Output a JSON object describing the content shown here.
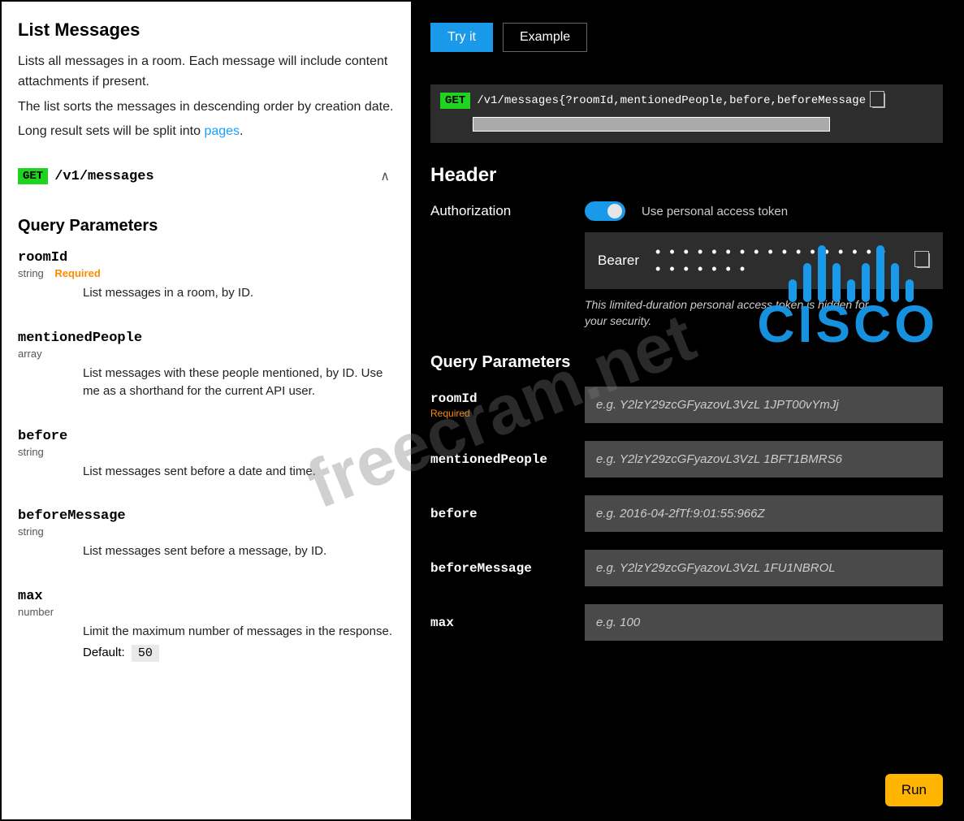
{
  "left": {
    "title": "List Messages",
    "desc1": "Lists all messages in a room. Each message will include content attachments if present.",
    "desc2": "The list sorts the messages in descending order by creation date.",
    "desc3_pre": "Long result sets will be split into ",
    "desc3_link": "pages",
    "desc3_post": ".",
    "method": "GET",
    "path": "/v1/messages",
    "qp_heading": "Query Parameters",
    "params": {
      "roomId": {
        "name": "roomId",
        "type": "string",
        "required": "Required",
        "desc": "List messages in a room, by ID."
      },
      "mentionedPeople": {
        "name": "mentionedPeople",
        "type": "array",
        "desc": "List messages with these people mentioned, by ID. Use me as a shorthand for the current API user."
      },
      "before": {
        "name": "before",
        "type": "string",
        "desc": "List messages sent before a date and time."
      },
      "beforeMessage": {
        "name": "beforeMessage",
        "type": "string",
        "desc": "List messages sent before a message, by ID."
      },
      "max": {
        "name": "max",
        "type": "number",
        "desc": "Limit the maximum number of messages in the response.",
        "default_label": "Default:",
        "default_val": "50"
      }
    }
  },
  "right": {
    "tabs": {
      "tryit": "Try it",
      "example": "Example"
    },
    "method": "GET",
    "url_template": "/v1/messages{?roomId,mentionedPeople,before,beforeMessage",
    "header_heading": "Header",
    "auth_label": "Authorization",
    "toggle_label": "Use personal access token",
    "bearer_label": "Bearer",
    "bearer_masked": "• • • • • • • • • • • • • • • • • • • • • • • •",
    "bearer_note": "This limited-duration personal access token is hidden for your security.",
    "qp_heading": "Query Parameters",
    "params": {
      "roomId": {
        "name": "roomId",
        "required": "Required",
        "placeholder": "e.g. Y2lzY29zcGFyazovL3VzL 1JPT00vYmJj"
      },
      "mentionedPeople": {
        "name": "mentionedPeople",
        "placeholder": "e.g. Y2lzY29zcGFyazovL3VzL 1BFT1BMRS6"
      },
      "before": {
        "name": "before",
        "placeholder": "e.g. 2016-04-2fTf:9:01:55:966Z"
      },
      "beforeMessage": {
        "name": "beforeMessage",
        "placeholder": "e.g. Y2lzY29zcGFyazovL3VzL 1FU1NBROL"
      },
      "max": {
        "name": "max",
        "placeholder": "e.g. 100"
      }
    },
    "run_label": "Run"
  },
  "watermark": "freecram.net",
  "cisco": "CISCO"
}
